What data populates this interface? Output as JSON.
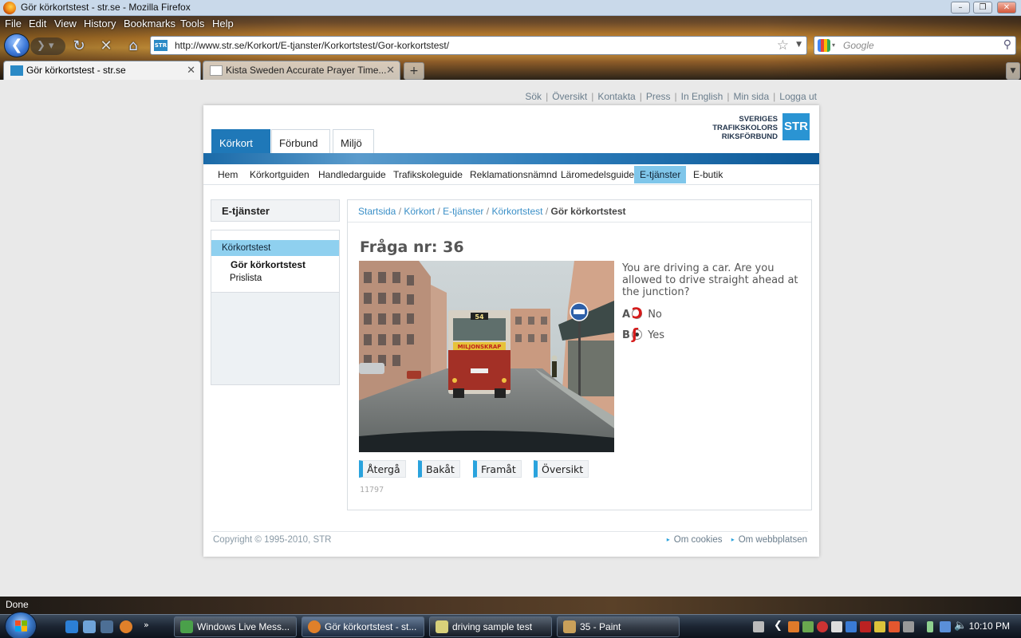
{
  "browser": {
    "window_title": "Gör körkortstest - str.se - Mozilla Firefox",
    "window_buttons": [
      "–",
      "❐",
      "✕"
    ],
    "menu": [
      "File",
      "Edit",
      "View",
      "History",
      "Bookmarks",
      "Tools",
      "Help"
    ],
    "url": "http://www.str.se/Korkort/E-tjanster/Korkortstest/Gor-korkortstest/",
    "site_icon_text": "STR",
    "search_placeholder": "Google",
    "tabs": [
      {
        "label": "Gör körkortstest - str.se",
        "active": true
      },
      {
        "label": "Kista Sweden Accurate Prayer Time...",
        "active": false
      }
    ],
    "new_tab_label": "+",
    "status_text": "Done"
  },
  "page": {
    "top_links": [
      "Sök",
      "Översikt",
      "Kontakta",
      "Press",
      "In English",
      "Min sida",
      "Logga ut"
    ],
    "logo": {
      "line1": "SVERIGES",
      "line2": "TRAFIKSKOLORS",
      "line3": "RIKSFÖRBUND",
      "mark": "STR"
    },
    "main_tabs": [
      "Körkort",
      "Förbund",
      "Miljö"
    ],
    "sub_nav": [
      "Hem",
      "Körkortguiden",
      "Handledarguide",
      "Trafikskoleguide",
      "Reklamationsnämnd",
      "Läromedelsguide",
      "E-tjänster",
      "E-butik"
    ],
    "sub_nav_active": "E-tjänster",
    "sidebar": {
      "heading": "E-tjänster",
      "items": [
        "Körkortstest",
        "Gör körkortstest",
        "Prislista"
      ]
    },
    "breadcrumb": {
      "links": [
        "Startsida",
        "Körkort",
        "E-tjänster",
        "Körkortstest"
      ],
      "current": "Gör körkortstest",
      "separator": " / "
    },
    "question": {
      "title": "Fråga nr: 36",
      "text": "You are driving a car. Are you allowed to drive straight ahead at the junction?",
      "answers": [
        {
          "letter": "A",
          "label": "No",
          "selected": false
        },
        {
          "letter": "B",
          "label": "Yes",
          "selected": true
        }
      ],
      "photo": {
        "bus_route": "54",
        "bus_ad": "MILJONSKRAP"
      },
      "buttons": [
        "Återgå",
        "Bakåt",
        "Framåt",
        "Översikt"
      ],
      "id": "11797"
    },
    "footer": {
      "copyright": "Copyright © 1995-2010, STR",
      "links": [
        "Om cookies",
        "Om webbplatsen"
      ]
    }
  },
  "taskbar": {
    "buttons": [
      {
        "label": "Windows Live Mess...",
        "active": false
      },
      {
        "label": "Gör körkortstest - st...",
        "active": true
      },
      {
        "label": "driving sample test",
        "active": false
      },
      {
        "label": "35 - Paint",
        "active": false
      }
    ],
    "clock": "10:10 PM"
  },
  "colors": {
    "accent": "#1f78b8",
    "link": "#3a8fc7",
    "highlight": "#7fc6ea",
    "mark": "#d61a1a"
  }
}
